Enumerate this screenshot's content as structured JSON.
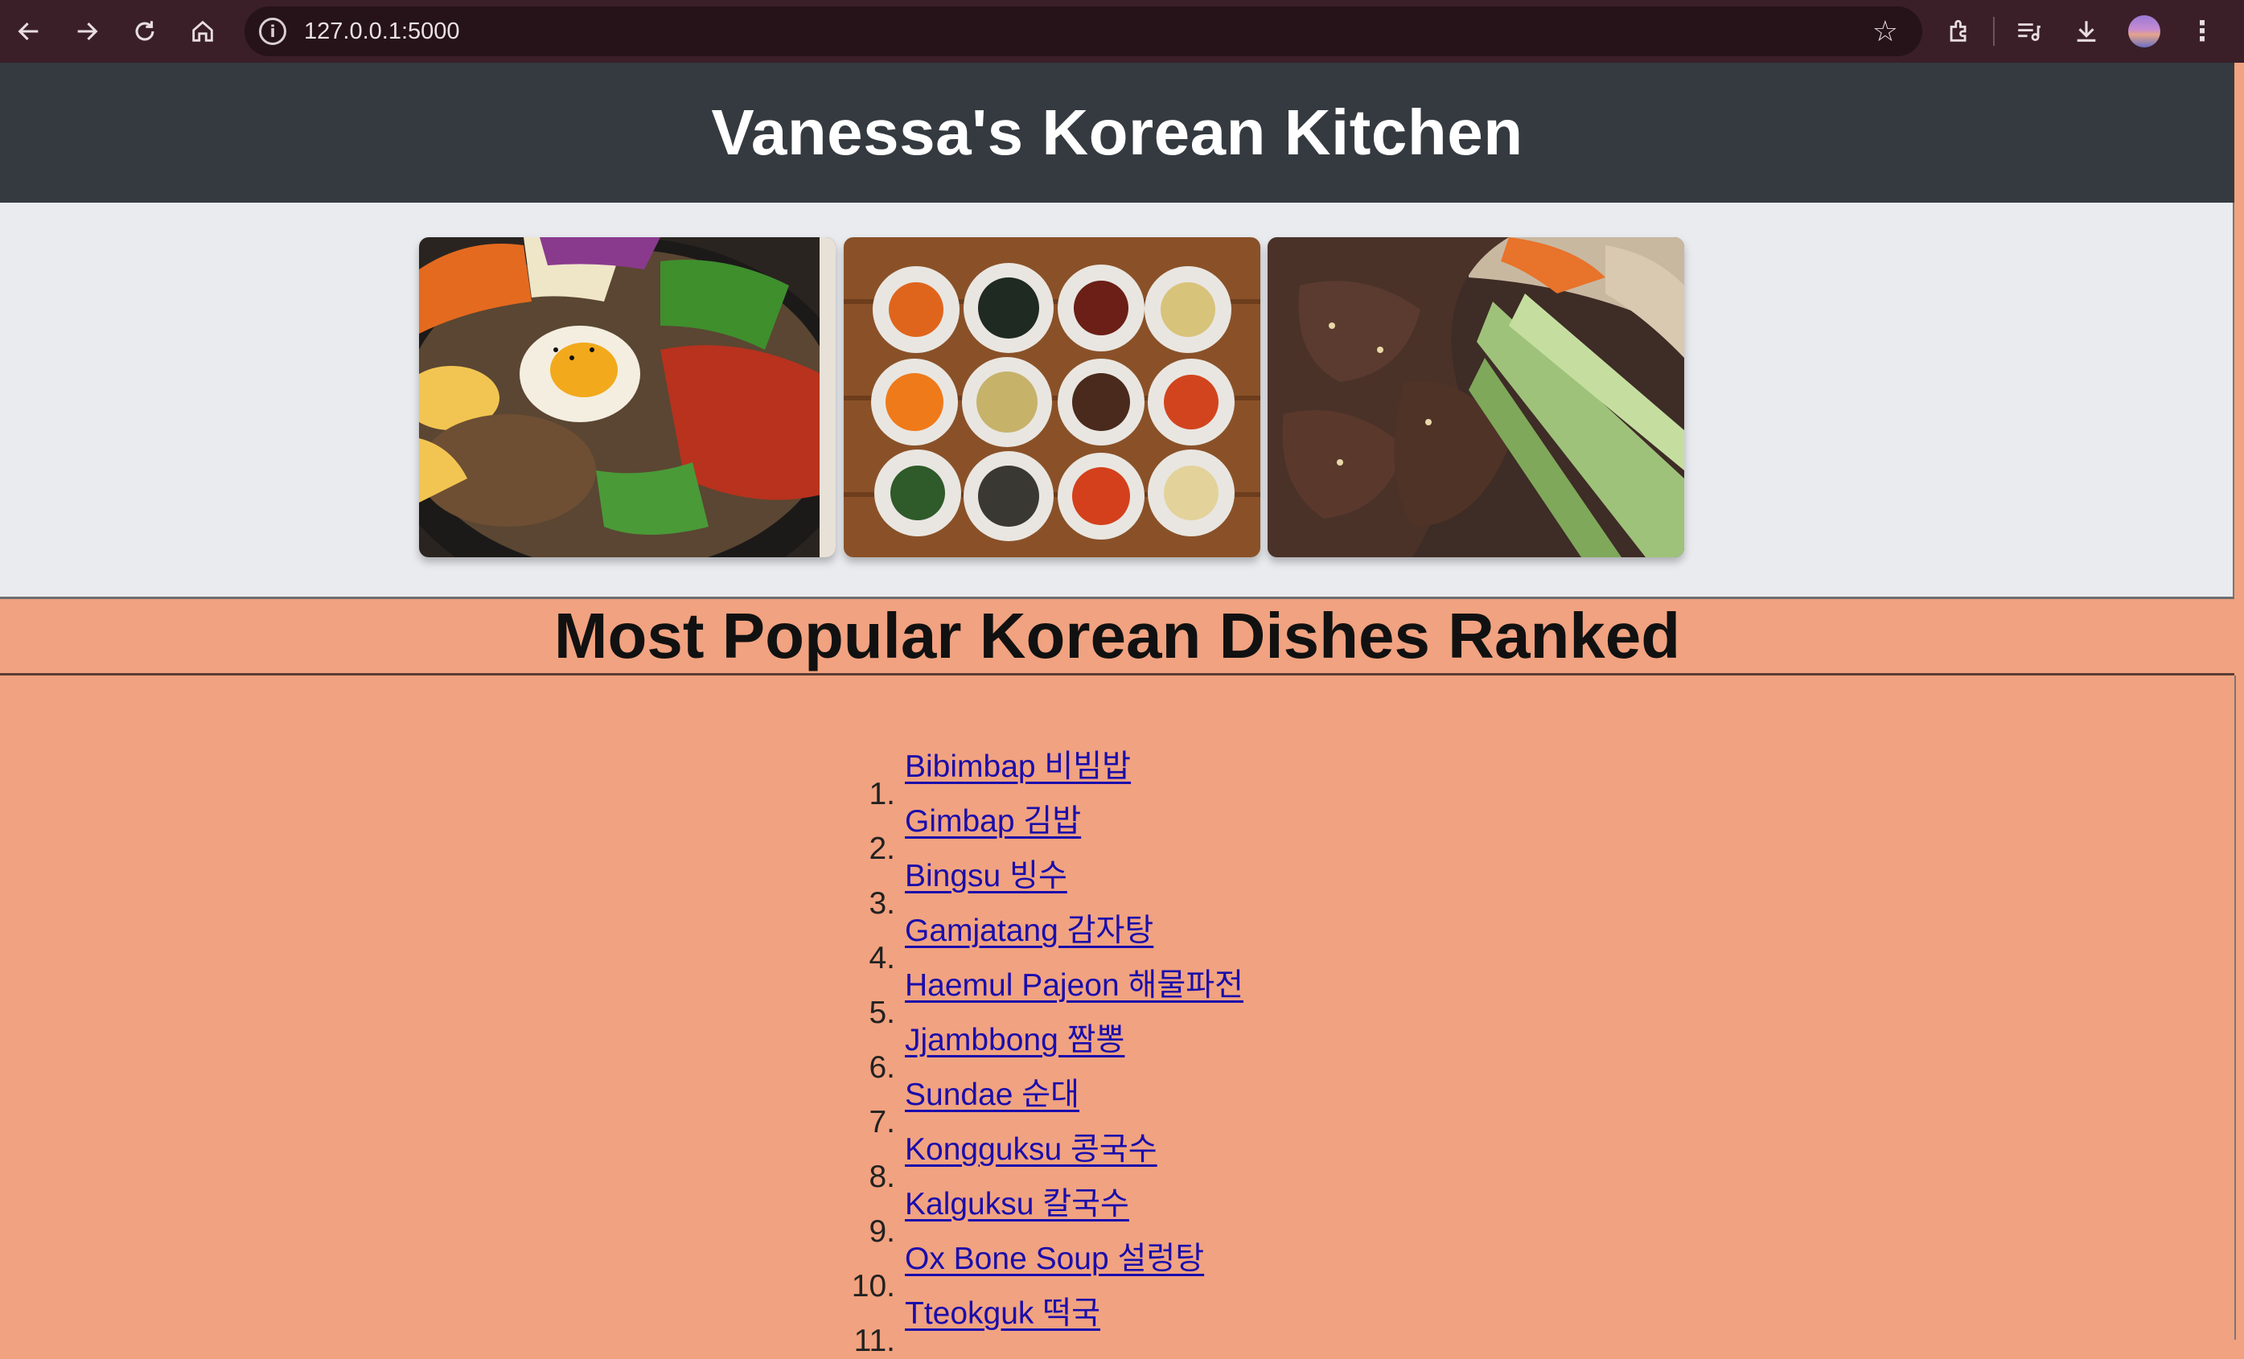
{
  "browser": {
    "url": "127.0.0.1:5000",
    "icons": [
      "back-arrow-icon",
      "forward-arrow-icon",
      "reload-icon",
      "home-icon",
      "info-icon",
      "bookmark-star-icon",
      "extensions-icon",
      "media-control-icon",
      "download-icon",
      "profile-avatar-icon",
      "menu-kebab-icon"
    ]
  },
  "site": {
    "title": "Vanessa's Korean Kitchen",
    "header_bg": "#343a40",
    "page_bg": "#f1a280"
  },
  "gallery": {
    "images": [
      {
        "subject": "bibimbap bowl"
      },
      {
        "subject": "banchan side dishes"
      },
      {
        "subject": "bulgogi with cucumber"
      }
    ]
  },
  "ranking": {
    "title": "Most Popular Korean Dishes Ranked",
    "items": [
      {
        "num": "1.",
        "label": "Bibimbap 비빔밥"
      },
      {
        "num": "2.",
        "label": "Gimbap 김밥"
      },
      {
        "num": "3.",
        "label": "Bingsu 빙수"
      },
      {
        "num": "4.",
        "label": "Gamjatang 감자탕"
      },
      {
        "num": "5.",
        "label": "Haemul Pajeon 해물파전"
      },
      {
        "num": "6.",
        "label": "Jjambbong 짬뽕"
      },
      {
        "num": "7.",
        "label": "Sundae 순대"
      },
      {
        "num": "8.",
        "label": "Kongguksu 콩국수"
      },
      {
        "num": "9.",
        "label": "Kalguksu 칼국수"
      },
      {
        "num": "10.",
        "label": "Ox Bone Soup 설렁탕"
      },
      {
        "num": "11.",
        "label": "Tteokguk 떡국"
      }
    ]
  }
}
